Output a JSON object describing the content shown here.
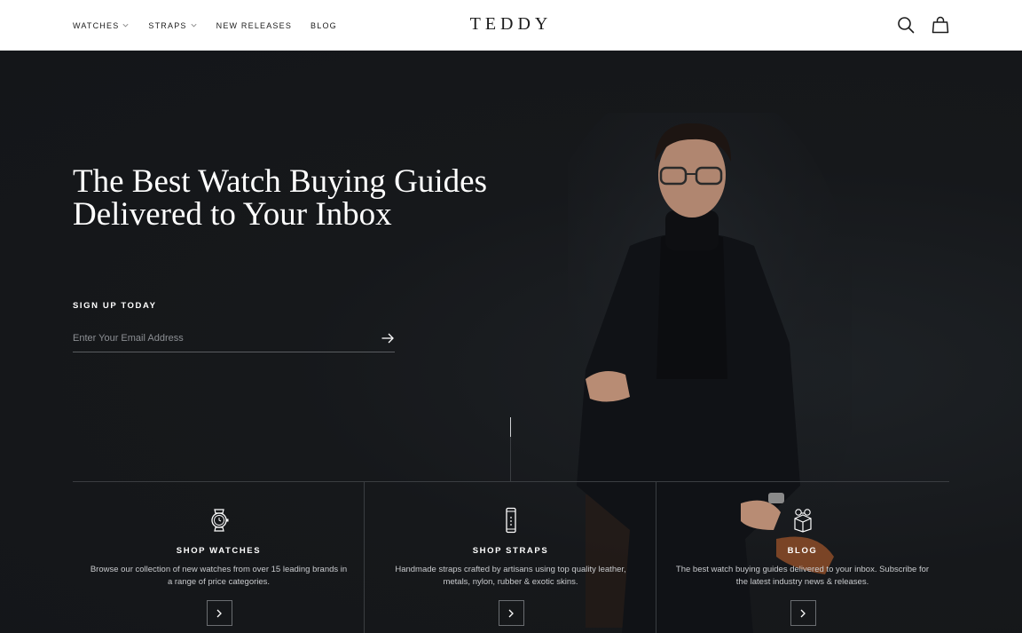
{
  "header": {
    "nav": [
      {
        "label": "WATCHES",
        "dropdown": true
      },
      {
        "label": "STRAPS",
        "dropdown": true
      },
      {
        "label": "NEW RELEASES",
        "dropdown": false
      },
      {
        "label": "BLOG",
        "dropdown": false
      }
    ],
    "logo": "TEDDY",
    "icons": [
      "search-icon",
      "shopping-bag-icon"
    ]
  },
  "hero": {
    "headline": "The Best Watch Buying Guides Delivered to Your Inbox",
    "signup_label": "SIGN UP TODAY",
    "email_placeholder": "Enter Your Email Address",
    "submit_icon": "arrow-right-icon"
  },
  "cards": [
    {
      "icon": "watch-icon",
      "title": "SHOP WATCHES",
      "text": "Browse our collection of new watches from over 15 leading brands in a range of price categories.",
      "button_icon": "chevron-right-icon"
    },
    {
      "icon": "strap-icon",
      "title": "SHOP STRAPS",
      "text": "Handmade straps crafted by artisans using top quality leather, metals, nylon, rubber & exotic skins.",
      "button_icon": "chevron-right-icon"
    },
    {
      "icon": "gift-box-icon",
      "title": "BLOG",
      "text": "The best watch buying guides delivered to your inbox. Subscribe for the latest industry news & releases.",
      "button_icon": "chevron-right-icon"
    }
  ],
  "colors": {
    "header_bg": "#ffffff",
    "hero_bg": "#16181b",
    "text_light": "#ffffff",
    "text_dark": "#1b1b1b",
    "muted": "#c9cbce"
  }
}
